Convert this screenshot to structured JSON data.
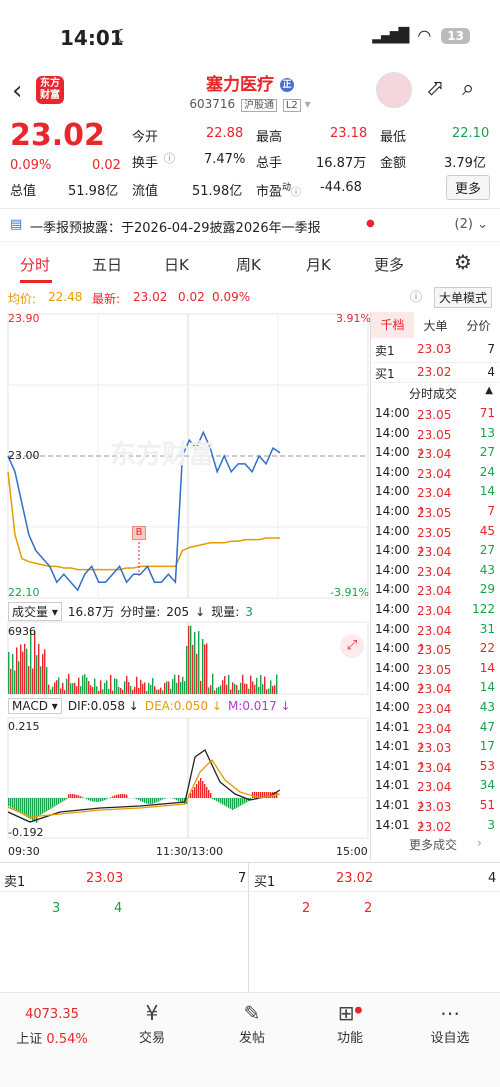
{
  "status_bar": {
    "time": "14:01",
    "battery": "13"
  },
  "header": {
    "logo_text": "东方财富",
    "stock_name": "塞力医疗",
    "stock_code": "603716",
    "market_tag": "沪股通",
    "level_tag": "L2"
  },
  "quote": {
    "price": "23.02",
    "change_pct": "0.09%",
    "change": "0.02",
    "open_label": "今开",
    "open": "22.88",
    "high_label": "最高",
    "high": "23.18",
    "low_label": "最低",
    "low": "22.10",
    "turnover_label": "换手",
    "turnover": "7.47%",
    "volume_label": "总手",
    "volume": "16.87万",
    "amount_label": "金额",
    "amount": "3.79亿",
    "mktcap_label": "总值",
    "mktcap": "51.98亿",
    "float_label": "流值",
    "float": "51.98亿",
    "pe_label": "市盈",
    "pe_sup": "动",
    "pe": "-44.68",
    "more_label": "更多"
  },
  "notice": {
    "text": "一季报预披露：于2026-04-29披露2026年一季报",
    "count": "(2)"
  },
  "tabs": [
    "分时",
    "五日",
    "日K",
    "周K",
    "月K",
    "更多"
  ],
  "info_line": {
    "avg_label": "均价:",
    "avg": "22.48",
    "latest_label": "最新:",
    "latest": "23.02",
    "chg": "0.02",
    "pct": "0.09%",
    "big_order_label": "大单模式"
  },
  "chart_labels": {
    "price_top": "23.90",
    "pct_top": "3.91%",
    "price_mid": "23.00",
    "price_bottom": "22.10",
    "pct_bottom": "-3.91%",
    "watermark": "东方财富",
    "buy_marker": "B",
    "vol_title": "成交量",
    "vol_total": "16.87万",
    "vol_split_label": "分时量:",
    "vol_split": "205",
    "vol_now_label": "现量:",
    "vol_now": "3",
    "vol_max": "6936",
    "macd_title": "MACD",
    "dif": "DIF:0.058",
    "dea": "DEA:0.050",
    "m": "M:0.017",
    "macd_top": "0.215",
    "macd_bottom": "-0.192",
    "time_start": "09:30",
    "time_mid": "11:30/13:00",
    "time_end": "15:00"
  },
  "chart_data": {
    "type": "line",
    "title": "",
    "ylim": [
      22.1,
      23.9
    ],
    "price_series": [
      23.0,
      22.9,
      22.7,
      22.5,
      22.4,
      22.35,
      22.3,
      22.2,
      22.25,
      22.2,
      22.15,
      22.25,
      22.3,
      22.2,
      22.2,
      22.25,
      22.3,
      22.2,
      22.25,
      22.25,
      22.3,
      22.2,
      22.2,
      22.25,
      22.2,
      23.0,
      23.1,
      23.05,
      23.15,
      23.05,
      22.9,
      23.0,
      22.9,
      22.95,
      22.95,
      22.9,
      23.0,
      22.95,
      23.05,
      23.02
    ],
    "avg_series": [
      22.9,
      22.5,
      22.35,
      22.33,
      22.32,
      22.31,
      22.3,
      22.3,
      22.29,
      22.29,
      22.28,
      22.28,
      22.28,
      22.28,
      22.28,
      22.28,
      22.28,
      22.29,
      22.29,
      22.3,
      22.3,
      22.3,
      22.3,
      22.3,
      22.3,
      22.4,
      22.42,
      22.43,
      22.44,
      22.45,
      22.45,
      22.45,
      22.46,
      22.46,
      22.47,
      22.47,
      22.47,
      22.48,
      22.48,
      22.48
    ]
  },
  "right_panel": {
    "tabs": [
      "千档",
      "大单",
      "分价"
    ],
    "ask1_label": "卖1",
    "ask1_price": "23.03",
    "ask1_vol": "7",
    "bid1_label": "买1",
    "bid1_price": "23.02",
    "bid1_vol": "4",
    "trades_title": "分时成交",
    "trades": [
      {
        "t": "14:00",
        "p": "23.05",
        "a": "",
        "v": "71",
        "c": "r"
      },
      {
        "t": "14:00",
        "p": "23.05",
        "a": "",
        "v": "13",
        "c": "g"
      },
      {
        "t": "14:00",
        "p": "23.04",
        "a": "↓",
        "v": "27",
        "c": "g"
      },
      {
        "t": "14:00",
        "p": "23.04",
        "a": "",
        "v": "24",
        "c": "g"
      },
      {
        "t": "14:00",
        "p": "23.04",
        "a": "",
        "v": "14",
        "c": "g"
      },
      {
        "t": "14:00",
        "p": "23.05",
        "a": "↑",
        "v": "7",
        "c": "r"
      },
      {
        "t": "14:00",
        "p": "23.05",
        "a": "",
        "v": "45",
        "c": "r"
      },
      {
        "t": "14:00",
        "p": "23.04",
        "a": "↓",
        "v": "27",
        "c": "g"
      },
      {
        "t": "14:00",
        "p": "23.04",
        "a": "",
        "v": "43",
        "c": "g"
      },
      {
        "t": "14:00",
        "p": "23.04",
        "a": "",
        "v": "29",
        "c": "g"
      },
      {
        "t": "14:00",
        "p": "23.04",
        "a": "",
        "v": "122",
        "c": "g"
      },
      {
        "t": "14:00",
        "p": "23.04",
        "a": "",
        "v": "31",
        "c": "g"
      },
      {
        "t": "14:00",
        "p": "23.05",
        "a": "↑",
        "v": "22",
        "c": "r"
      },
      {
        "t": "14:00",
        "p": "23.05",
        "a": "",
        "v": "14",
        "c": "r"
      },
      {
        "t": "14:00",
        "p": "23.04",
        "a": "↓",
        "v": "14",
        "c": "g"
      },
      {
        "t": "14:00",
        "p": "23.04",
        "a": "",
        "v": "43",
        "c": "g"
      },
      {
        "t": "14:01",
        "p": "23.04",
        "a": "",
        "v": "47",
        "c": "g"
      },
      {
        "t": "14:01",
        "p": "23.03",
        "a": "↓",
        "v": "17",
        "c": "g"
      },
      {
        "t": "14:01",
        "p": "23.04",
        "a": "↑",
        "v": "53",
        "c": "r"
      },
      {
        "t": "14:01",
        "p": "23.04",
        "a": "",
        "v": "34",
        "c": "g"
      },
      {
        "t": "14:01",
        "p": "23.03",
        "a": "↓",
        "v": "51",
        "c": "r"
      },
      {
        "t": "14:01",
        "p": "23.02",
        "a": "↓",
        "v": "3",
        "c": "g"
      }
    ],
    "more_trades": "更多成交"
  },
  "book": {
    "ask_label": "卖1",
    "ask_price": "23.03",
    "ask_vol": "7",
    "bid_label": "买1",
    "bid_price": "23.02",
    "bid_vol": "4",
    "left_a": "3",
    "left_b": "4",
    "right_a": "2",
    "right_b": "2"
  },
  "nav": {
    "index_value": "4073.35",
    "index_name": "上证",
    "index_pct": "0.54%",
    "items": [
      "交易",
      "发帖",
      "功能",
      "设自选"
    ]
  }
}
